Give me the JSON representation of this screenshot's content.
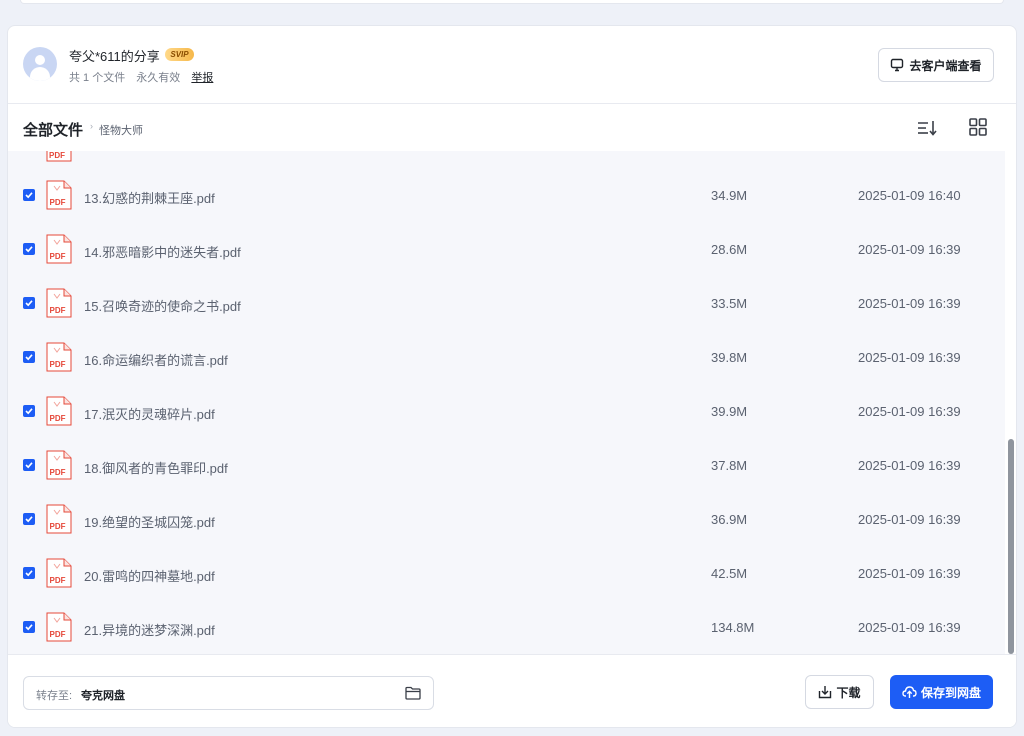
{
  "header": {
    "share_title": "夸父*611的分享",
    "svip_badge": "SVIP",
    "file_count": "共 1 个文件",
    "validity": "永久有效",
    "report": "举报",
    "client_button": "去客户端查看"
  },
  "toolbar": {
    "crumb_root": "全部文件",
    "crumb_separator": "›",
    "crumb_current": "怪物大师",
    "sort_icon": "sort-icon",
    "grid_icon": "grid-view-icon"
  },
  "files": [
    {
      "name": "13.幻惑的荆棘王座.pdf",
      "size": "34.9M",
      "date": "2025-01-09 16:40",
      "checked": true
    },
    {
      "name": "14.邪恶暗影中的迷失者.pdf",
      "size": "28.6M",
      "date": "2025-01-09 16:39",
      "checked": true
    },
    {
      "name": "15.召唤奇迹的使命之书.pdf",
      "size": "33.5M",
      "date": "2025-01-09 16:39",
      "checked": true
    },
    {
      "name": "16.命运编织者的谎言.pdf",
      "size": "39.8M",
      "date": "2025-01-09 16:39",
      "checked": true
    },
    {
      "name": "17.泯灭的灵魂碎片.pdf",
      "size": "39.9M",
      "date": "2025-01-09 16:39",
      "checked": true
    },
    {
      "name": "18.御风者的青色罪印.pdf",
      "size": "37.8M",
      "date": "2025-01-09 16:39",
      "checked": true
    },
    {
      "name": "19.绝望的圣城囚笼.pdf",
      "size": "36.9M",
      "date": "2025-01-09 16:39",
      "checked": true
    },
    {
      "name": "20.雷鸣的四神墓地.pdf",
      "size": "42.5M",
      "date": "2025-01-09 16:39",
      "checked": true
    },
    {
      "name": "21.异境的迷梦深渊.pdf",
      "size": "134.8M",
      "date": "2025-01-09 16:39",
      "checked": true
    }
  ],
  "pdf_label": "PDF",
  "footer": {
    "save_to_label": "转存至:",
    "save_to_value": "夸克网盘",
    "download_button": "下载",
    "save_button": "保存到网盘"
  },
  "colors": {
    "accent": "#1d5df5",
    "pdf_red": "#e5483a",
    "list_bg": "#f6f7fb"
  }
}
